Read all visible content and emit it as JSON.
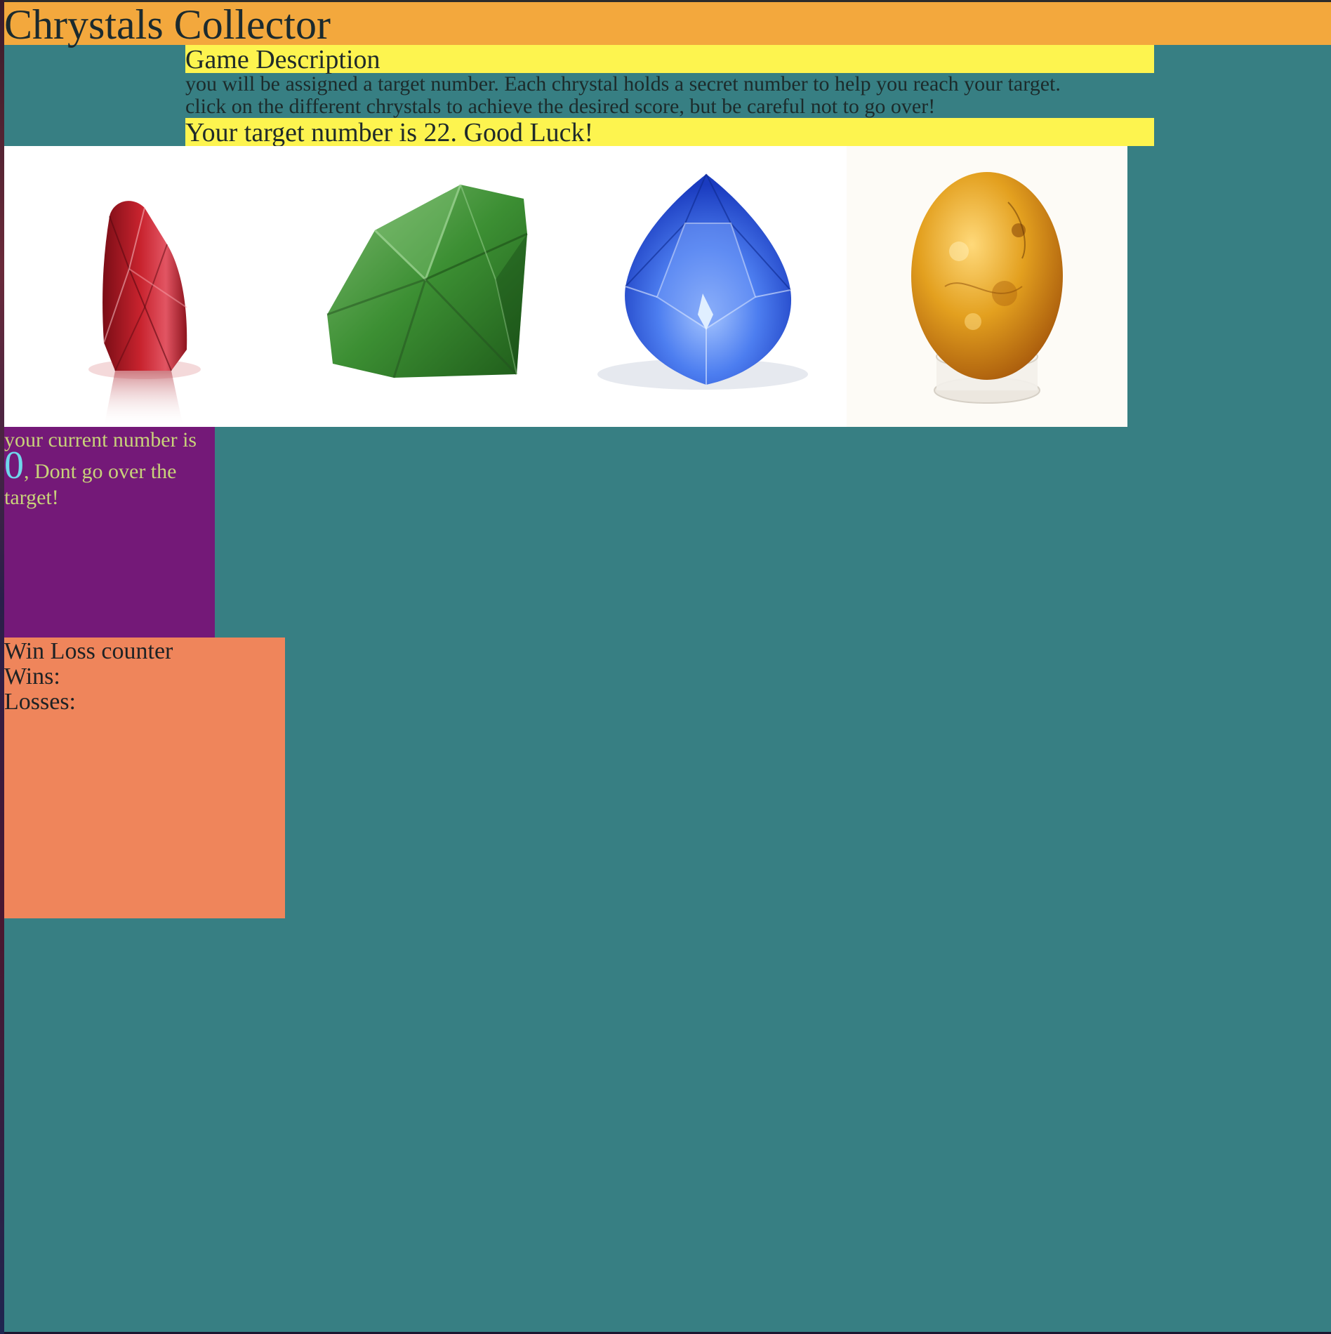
{
  "app": {
    "title": "Chrystals Collector"
  },
  "description": {
    "heading": "Game Description",
    "line1": "you will be assigned a target number. Each chrystal holds a secret number to help you reach your target.",
    "line2": "click on the different chrystals to achieve the desired score, but be careful not to go over!"
  },
  "target": {
    "text": "Your target number is 22. Good Luck!",
    "value": 22
  },
  "crystals": [
    {
      "name": "red-crystal",
      "icon": "red-gem-icon",
      "color": "#c7222b"
    },
    {
      "name": "green-crystal",
      "icon": "green-gem-icon",
      "color": "#2f8a2a"
    },
    {
      "name": "blue-crystal",
      "icon": "blue-gem-icon",
      "color": "#2d56d6"
    },
    {
      "name": "amber-crystal",
      "icon": "amber-egg-icon",
      "color": "#e3a01f"
    }
  ],
  "current": {
    "prefix": "your current number is",
    "value": "0",
    "suffix": ", Dont go over the target!"
  },
  "winloss": {
    "heading": "Win Loss counter",
    "wins_label": "Wins:",
    "losses_label": "Losses:"
  },
  "colors": {
    "header": "#f3a83d",
    "page_background": "#377f83",
    "banner": "#fdf44f",
    "current_box": "#741978",
    "winloss_box": "#ef855b"
  }
}
